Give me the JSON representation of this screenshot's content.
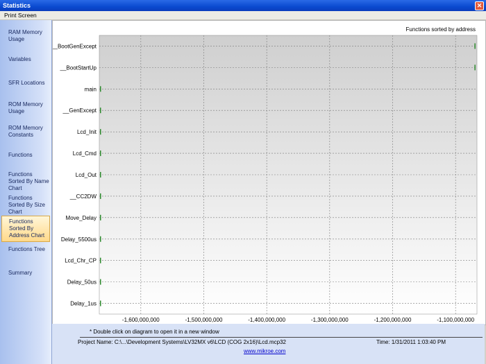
{
  "window": {
    "title": "Statistics"
  },
  "menu": {
    "print_screen": "Print Screen"
  },
  "sidebar": {
    "active_index": 8,
    "items": [
      "RAM Memory Usage",
      "Variables",
      "SFR Locations",
      "ROM Memory Usage",
      "ROM Memory Constants",
      "Functions",
      "Functions Sorted By Name Chart",
      "Functions Sorted By Size Chart",
      "Functions Sorted By Address Chart",
      "Functions Tree",
      "Summary"
    ]
  },
  "chart_data": {
    "type": "bar",
    "orientation": "horizontal",
    "title": "Functions sorted by address",
    "categories": [
      "__BootGenExcept",
      "__BootStartUp",
      "main",
      "__GenExcept",
      "Lcd_Init",
      "Lcd_Cmd",
      "Lcd_Out",
      "__CC2DW",
      "Move_Delay",
      "Delay_5500us",
      "Lcd_Chr_CP",
      "Delay_50us",
      "Delay_1us"
    ],
    "values": [
      -1070000000,
      -1070000000,
      -1666000000,
      -1666000000,
      -1666000000,
      -1666000000,
      -1666000000,
      -1666000000,
      -1666000000,
      -1666000000,
      -1666000000,
      -1666000000,
      -1666000000
    ],
    "xticks": [
      -1600000000,
      -1500000000,
      -1400000000,
      -1300000000,
      -1200000000,
      -1100000000
    ],
    "xtick_labels": [
      "-1,600,000,000",
      "-1,500,000,000",
      "-1,400,000,000",
      "-1,300,000,000",
      "-1,200,000,000",
      "-1,100,000,000"
    ],
    "xlim": [
      -1666000000,
      -1066000000
    ],
    "grid": true,
    "bar_color": "#2e8b2e"
  },
  "footer": {
    "note": "* Double click on diagram to open it in a new window",
    "project": "Project Name:  C:\\...\\Development Systems\\LV32MX v6\\LCD (COG 2x16)\\Lcd.mcp32",
    "time": "Time:  1/31/2011 1:03:40 PM",
    "link": "www.mikroe.com"
  }
}
